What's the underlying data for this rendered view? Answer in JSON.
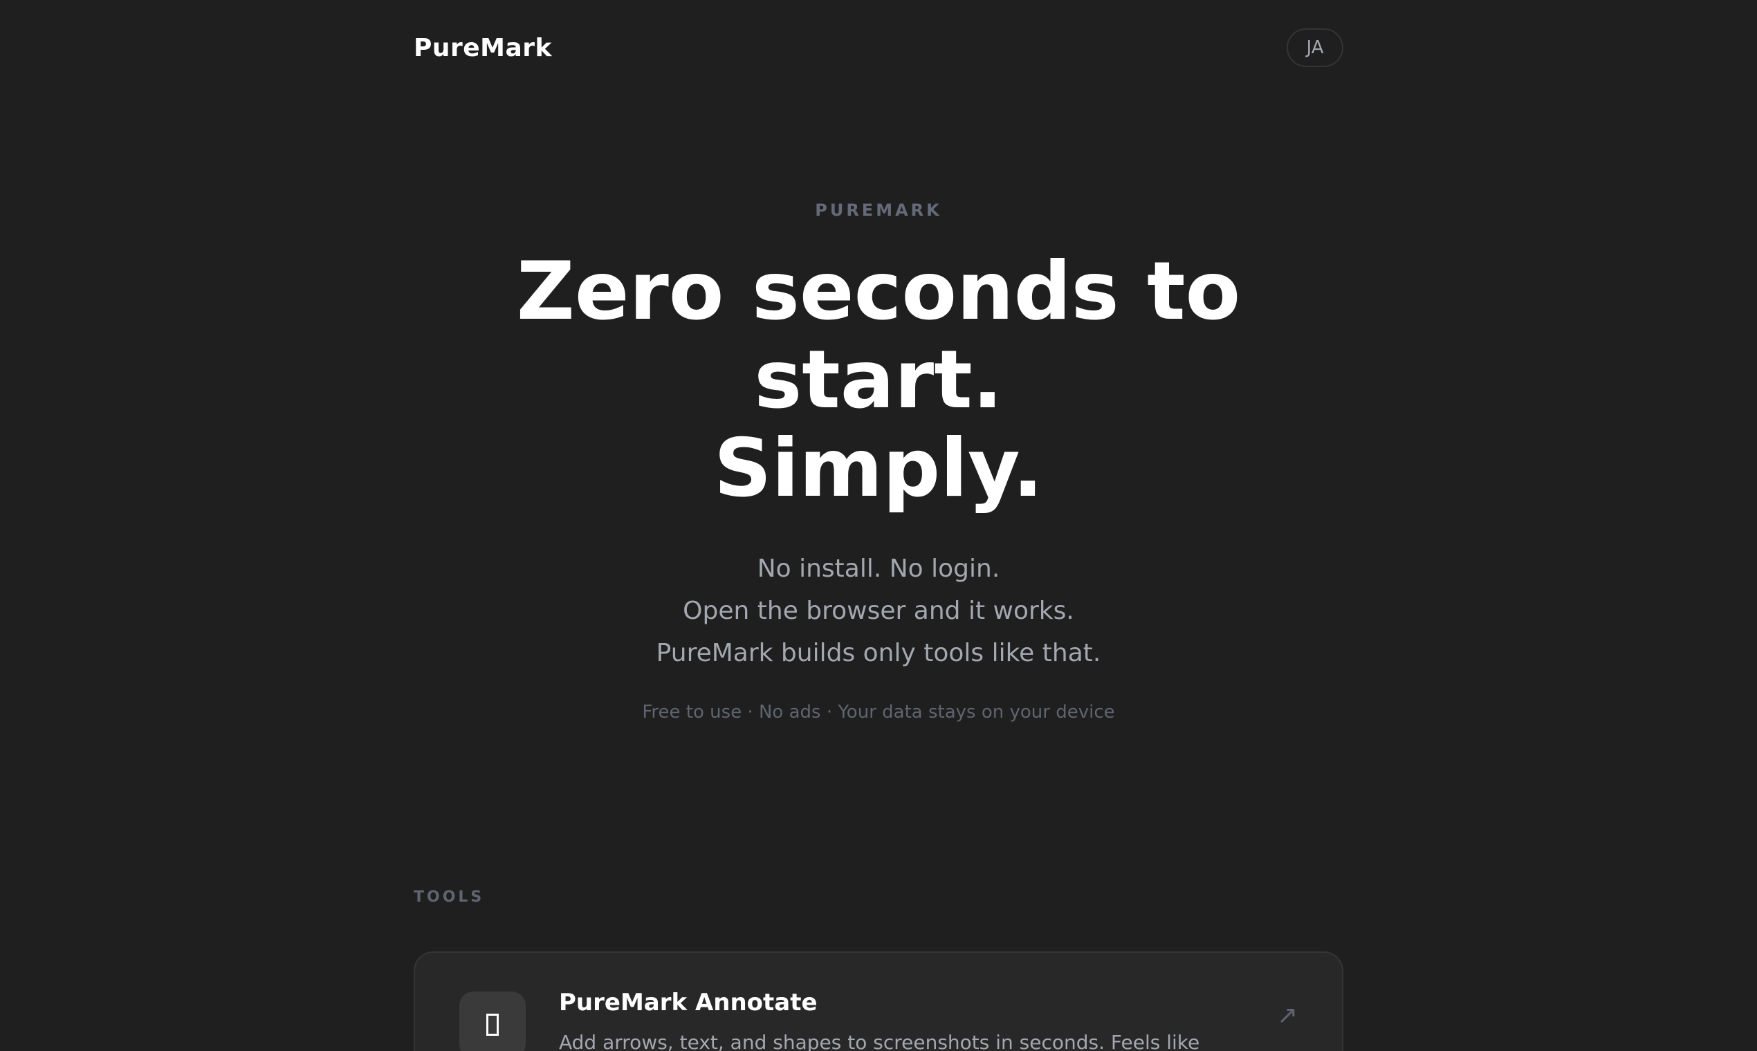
{
  "header": {
    "logo": "PureMark",
    "lang_button": "JA"
  },
  "hero": {
    "eyebrow": "PUREMARK",
    "headline_lines": [
      "Zero seconds to",
      "start.",
      "Simply."
    ],
    "subcopy_lines": [
      "No install. No login.",
      "Open the browser and it works.",
      "PureMark builds only tools like that."
    ],
    "meta": "Free to use · No ads · Your data stays on your device"
  },
  "tools": {
    "section_label": "TOOLS",
    "items": [
      {
        "name": "PureMark Annotate",
        "description": "Add arrows, text, and shapes to screenshots in seconds. Feels like",
        "icon": "tool-glyph-icon",
        "arrow_icon": "external-arrow-icon",
        "arrow_glyph": "↗"
      }
    ]
  },
  "colors": {
    "background": "#1f1f1f",
    "card": "#282828",
    "muted_text": "#a3a7b0",
    "dim_text": "#5f6470"
  }
}
